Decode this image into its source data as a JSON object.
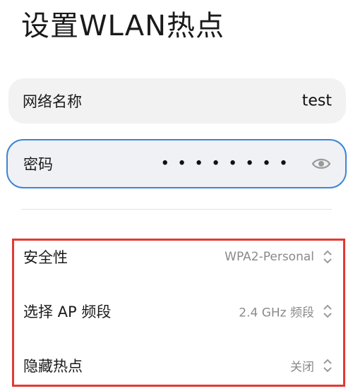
{
  "page": {
    "title": "设置WLAN热点"
  },
  "network_name": {
    "label": "网络名称",
    "value": "test"
  },
  "password": {
    "label": "密码",
    "masked_value": "••••••••",
    "toggle_icon": "eye-icon"
  },
  "settings": [
    {
      "label": "安全性",
      "value": "WPA2-Personal",
      "icon": "chevron-up-down-icon"
    },
    {
      "label": "选择 AP 频段",
      "value": "2.4 GHz 频段",
      "icon": "chevron-up-down-icon"
    },
    {
      "label": "隐藏热点",
      "value": "关闭",
      "icon": "chevron-up-down-icon"
    }
  ],
  "colors": {
    "focus_border": "#3a86d6",
    "highlight_border": "#e23a32",
    "field_background": "#f2f2f2",
    "secondary_text": "#8a8a8a"
  }
}
